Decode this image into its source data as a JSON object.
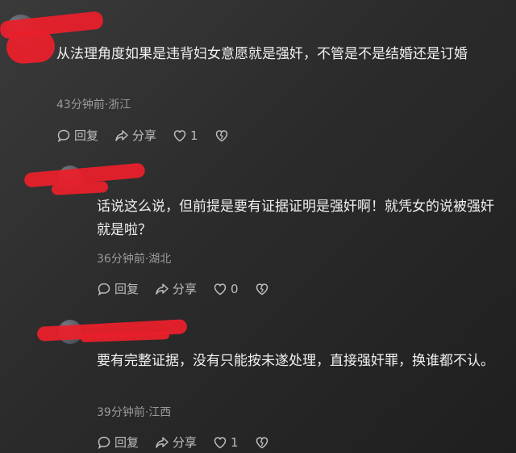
{
  "comments": [
    {
      "text": "从法理角度如果是违背妇女意愿就是强奸，不管是不是结婚还是订婚",
      "meta": "43分钟前·浙江",
      "reply_label": "回复",
      "share_label": "分享",
      "like_count": "1"
    },
    {
      "text": "话说这么说，但前提是要有证据证明是强奸啊！就凭女的说被强奸就是啦？",
      "meta": "36分钟前·湖北",
      "reply_label": "回复",
      "share_label": "分享",
      "like_count": "0"
    },
    {
      "text": "要有完整证据，没有只能按未遂处理，直接强奸罪，换谁都不认。",
      "meta": "39分钟前·江西",
      "reply_label": "回复",
      "share_label": "分享",
      "like_count": "1"
    }
  ],
  "colors": {
    "redaction": "#e8202b",
    "meta": "#9a9a9a",
    "text": "#f0f0f0"
  },
  "icons": [
    "comment-bubble-icon",
    "share-arrow-icon",
    "heart-icon",
    "dislike-heart-icon"
  ]
}
